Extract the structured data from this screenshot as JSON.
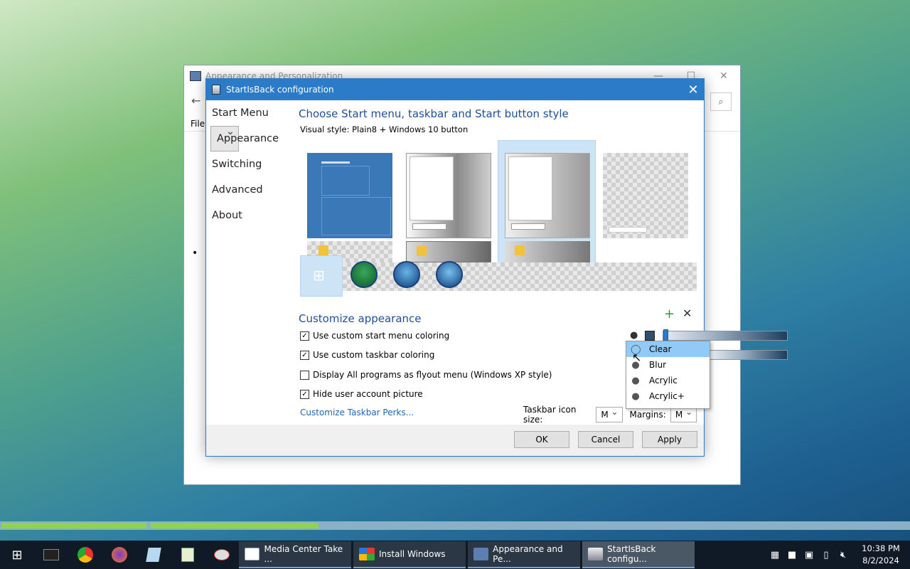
{
  "bg_window": {
    "title": "Appearance and Personalization",
    "menu_file": "File"
  },
  "dialog": {
    "title": "StartIsBack configuration",
    "sidebar": [
      "Start Menu",
      "Appearance",
      "Switching",
      "Advanced",
      "About"
    ],
    "heading": "Choose Start menu, taskbar and Start button style",
    "visual_style": "Visual style:  Plain8 + Windows 10 button",
    "customize_heading": "Customize appearance",
    "checkboxes": [
      {
        "label": "Use custom start menu coloring",
        "checked": true
      },
      {
        "label": "Use custom taskbar coloring",
        "checked": true
      },
      {
        "label": "Display All programs as flyout menu (Windows XP style)",
        "checked": false
      },
      {
        "label": "Hide user account picture",
        "checked": true
      }
    ],
    "link": "Customize Taskbar Perks...",
    "dropdown": {
      "options": [
        "Clear",
        "Blur",
        "Acrylic",
        "Acrylic+"
      ],
      "highlighted": "Clear"
    },
    "taskbar_icon_size_label": "Taskbar icon size:",
    "taskbar_icon_size": "M",
    "margins_label": "Margins:",
    "margins": "M",
    "buttons": {
      "ok": "OK",
      "cancel": "Cancel",
      "apply": "Apply"
    }
  },
  "taskbar": {
    "tasks": [
      "Media Center Take ...",
      "Install Windows",
      "Appearance and Pe...",
      "StartIsBack configu..."
    ],
    "time": "10:38 PM",
    "date": "8/2/2024"
  }
}
